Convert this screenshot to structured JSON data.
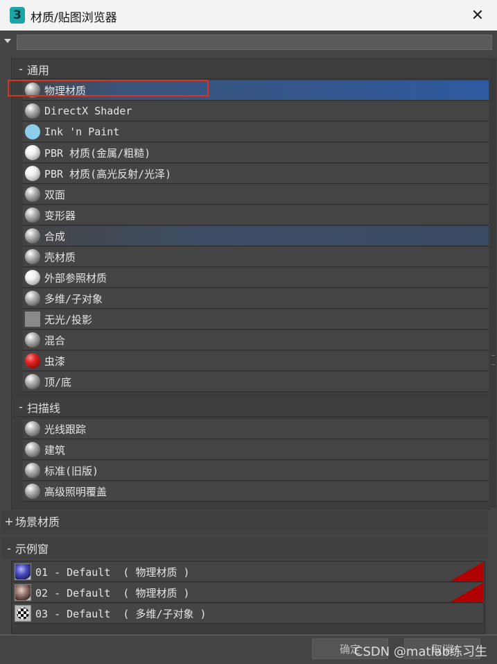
{
  "window": {
    "title": "材质/贴图浏览器",
    "app_icon_text": "3"
  },
  "search": {
    "value": "",
    "placeholder": ""
  },
  "groups": {
    "general": {
      "header": "通用",
      "sign": "-",
      "items": [
        {
          "label": "物理材质",
          "icon": "gray-sphere-icon"
        },
        {
          "label": "DirectX Shader",
          "icon": "gray-sphere-icon"
        },
        {
          "label": "Ink 'n Paint",
          "icon": "blue-circle-icon"
        },
        {
          "label": "PBR 材质(金属/粗糙)",
          "icon": "white-sphere-icon"
        },
        {
          "label": "PBR 材质(高光反射/光泽)",
          "icon": "white-sphere-icon"
        },
        {
          "label": "双面",
          "icon": "gray-sphere-icon"
        },
        {
          "label": "变形器",
          "icon": "gray-sphere-icon"
        },
        {
          "label": "合成",
          "icon": "gray-sphere-icon"
        },
        {
          "label": "壳材质",
          "icon": "gray-sphere-icon"
        },
        {
          "label": "外部参照材质",
          "icon": "white-sphere-icon"
        },
        {
          "label": "多维/子对象",
          "icon": "gray-sphere-icon"
        },
        {
          "label": "无光/投影",
          "icon": "gray-square-icon"
        },
        {
          "label": "混合",
          "icon": "gray-sphere-icon"
        },
        {
          "label": "虫漆",
          "icon": "red-sphere-icon"
        },
        {
          "label": "顶/底",
          "icon": "gray-sphere-icon"
        }
      ]
    },
    "scanline": {
      "header": "扫描线",
      "sign": "-",
      "items": [
        {
          "label": "光线跟踪",
          "icon": "gray-sphere-icon"
        },
        {
          "label": "建筑",
          "icon": "gray-sphere-icon"
        },
        {
          "label": "标准(旧版)",
          "icon": "gray-sphere-icon"
        },
        {
          "label": "高级照明覆盖",
          "icon": "gray-sphere-icon"
        }
      ]
    }
  },
  "scene_materials": {
    "header": "场景材质",
    "sign": "+"
  },
  "sample_slots": {
    "header": "示例窗",
    "sign": "-",
    "items": [
      {
        "label": "01 - Default  ( 物理材质 )",
        "thumb": "blue-sphere-thumb-icon"
      },
      {
        "label": "02 - Default  ( 物理材质 )",
        "thumb": "brown-sphere-thumb-icon"
      },
      {
        "label": "03 - Default  ( 多维/子对象 )",
        "thumb": "checker-sphere-thumb-icon"
      }
    ]
  },
  "buttons": {
    "ok": "确定",
    "cancel": "取消"
  },
  "watermark": "CSDN @matlab练习生",
  "colors": {
    "selected": "#2f5aa0",
    "highlight_box": "#e0301e",
    "slot_corner": "#b00000"
  }
}
